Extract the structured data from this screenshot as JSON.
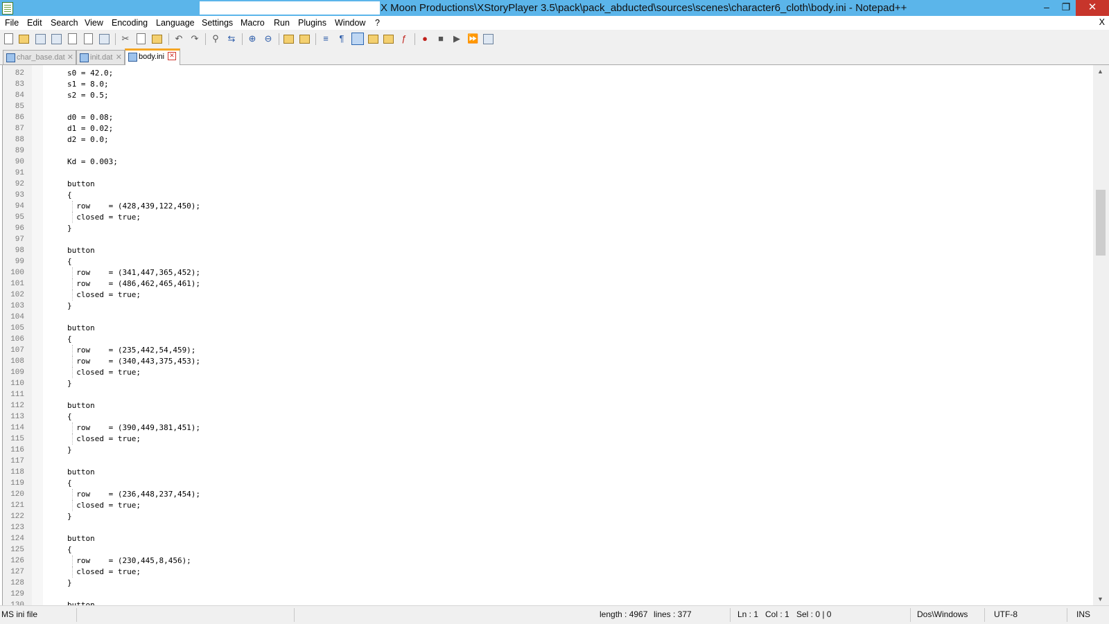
{
  "window": {
    "title": "X Moon Productions\\XStoryPlayer 3.5\\pack\\pack_abducted\\sources\\scenes\\character6_cloth\\body.ini - Notepad++",
    "minimize": "–",
    "maximize": "❐",
    "close": "✕"
  },
  "menu": {
    "items": [
      "File",
      "Edit",
      "Search",
      "View",
      "Encoding",
      "Language",
      "Settings",
      "Macro",
      "Run",
      "Plugins",
      "Window",
      "?"
    ],
    "close_doc": "X"
  },
  "toolbar": {
    "icons": [
      "new-file",
      "open-file",
      "save",
      "save-all",
      "close",
      "close-all",
      "print",
      "cut",
      "copy",
      "paste",
      "undo",
      "redo",
      "find",
      "replace",
      "zoom-in",
      "zoom-out",
      "sync-vertical",
      "sync-horizontal",
      "word-wrap",
      "show-all-characters",
      "indent-guide",
      "define-language",
      "folder-as-workspace",
      "function-list",
      "record-macro",
      "stop-recording",
      "playback-macro",
      "run-macro-multiple",
      "save-macro"
    ]
  },
  "tabs": [
    {
      "label": "char_base.dat",
      "active": false
    },
    {
      "label": "init.dat",
      "active": false
    },
    {
      "label": "body.ini",
      "active": true
    }
  ],
  "editor": {
    "lines": [
      {
        "n": "82",
        "text": "s0 = 42.0;"
      },
      {
        "n": "83",
        "text": "s1 = 8.0;"
      },
      {
        "n": "84",
        "text": "s2 = 0.5;"
      },
      {
        "n": "85",
        "text": ""
      },
      {
        "n": "86",
        "text": "d0 = 0.08;"
      },
      {
        "n": "87",
        "text": "d1 = 0.02;"
      },
      {
        "n": "88",
        "text": "d2 = 0.0;"
      },
      {
        "n": "89",
        "text": ""
      },
      {
        "n": "90",
        "text": "Kd = 0.003;"
      },
      {
        "n": "91",
        "text": ""
      },
      {
        "n": "92",
        "text": "button"
      },
      {
        "n": "93",
        "text": "{"
      },
      {
        "n": "94",
        "text": "  row    = (428,439,122,450);"
      },
      {
        "n": "95",
        "text": "  closed = true;"
      },
      {
        "n": "96",
        "text": "}"
      },
      {
        "n": "97",
        "text": ""
      },
      {
        "n": "98",
        "text": "button"
      },
      {
        "n": "99",
        "text": "{"
      },
      {
        "n": "100",
        "text": "  row    = (341,447,365,452);"
      },
      {
        "n": "101",
        "text": "  row    = (486,462,465,461);"
      },
      {
        "n": "102",
        "text": "  closed = true;"
      },
      {
        "n": "103",
        "text": "}"
      },
      {
        "n": "104",
        "text": ""
      },
      {
        "n": "105",
        "text": "button"
      },
      {
        "n": "106",
        "text": "{"
      },
      {
        "n": "107",
        "text": "  row    = (235,442,54,459);"
      },
      {
        "n": "108",
        "text": "  row    = (340,443,375,453);"
      },
      {
        "n": "109",
        "text": "  closed = true;"
      },
      {
        "n": "110",
        "text": "}"
      },
      {
        "n": "111",
        "text": ""
      },
      {
        "n": "112",
        "text": "button"
      },
      {
        "n": "113",
        "text": "{"
      },
      {
        "n": "114",
        "text": "  row    = (390,449,381,451);"
      },
      {
        "n": "115",
        "text": "  closed = true;"
      },
      {
        "n": "116",
        "text": "}"
      },
      {
        "n": "117",
        "text": ""
      },
      {
        "n": "118",
        "text": "button"
      },
      {
        "n": "119",
        "text": "{"
      },
      {
        "n": "120",
        "text": "  row    = (236,448,237,454);"
      },
      {
        "n": "121",
        "text": "  closed = true;"
      },
      {
        "n": "122",
        "text": "}"
      },
      {
        "n": "123",
        "text": ""
      },
      {
        "n": "124",
        "text": "button"
      },
      {
        "n": "125",
        "text": "{"
      },
      {
        "n": "126",
        "text": "  row    = (230,445,8,456);"
      },
      {
        "n": "127",
        "text": "  closed = true;"
      },
      {
        "n": "128",
        "text": "}"
      },
      {
        "n": "129",
        "text": ""
      },
      {
        "n": "130",
        "text": "button"
      }
    ]
  },
  "status": {
    "file_type": "MS ini file",
    "length": "length : 4967",
    "lines": "lines : 377",
    "ln": "Ln : 1",
    "col": "Col : 1",
    "sel": "Sel : 0 | 0",
    "eol": "Dos\\Windows",
    "encoding": "UTF-8",
    "mode": "INS"
  }
}
